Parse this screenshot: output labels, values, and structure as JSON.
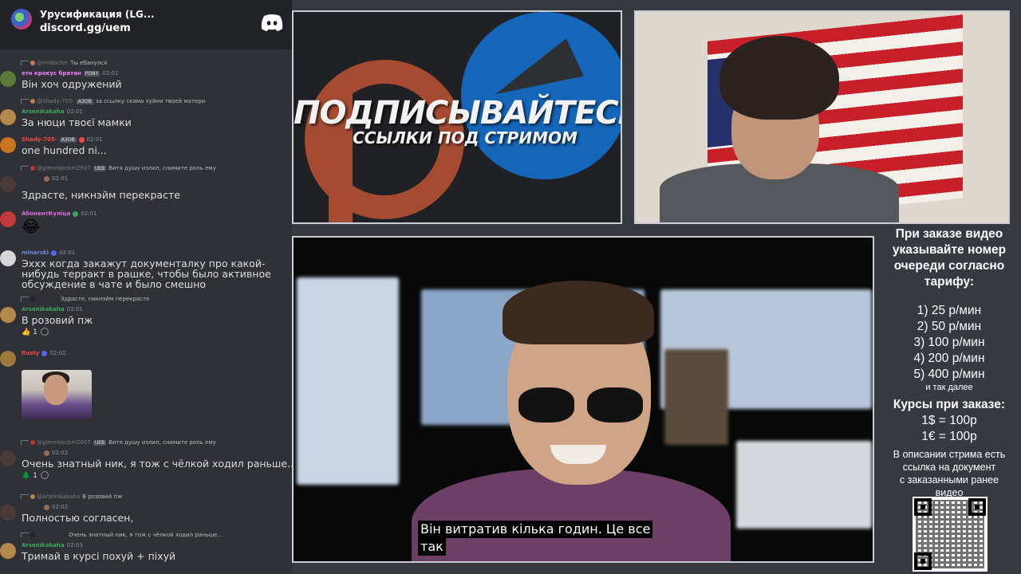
{
  "discord": {
    "server_name": "Урусификация (LG...",
    "invite": "discord.gg/uem",
    "messages": [
      {
        "reply_user": "@mrdoctor",
        "reply_text": "Ты ебанулся",
        "user": "ето крокус братан",
        "tag": "PONY",
        "time": "02:01",
        "text": "Він хоч одружений",
        "user_color": "#f47fff"
      },
      {
        "reply_user": "@Shady-705-",
        "reply_tag": "АЗОВ",
        "reply_text": "за ссылку скама хуйни твоей матери",
        "user": "Arsenikakaha",
        "time": "02:01",
        "text": "За нюци твоєї мамки",
        "user_color": "#3ba55d"
      },
      {
        "user": "Shady-705-",
        "tag": "АЗОВ",
        "time": "02:01",
        "text": "one hundred ni...",
        "user_color": "#f04747"
      },
      {
        "reply_user": "@glennbeckm2007",
        "reply_tag": "UEB",
        "reply_text": "Витя душу излил, снимите роль ему",
        "time": "02:01",
        "text": "Здрасте, никнэйм перекрасте"
      },
      {
        "user": "АбонентКуліца",
        "time": "02:01",
        "text": "😂",
        "user_color": "#e26de0"
      },
      {
        "user": "minarski",
        "time": "02:01",
        "text": "Эххх когда закажут документалку про какой-нибудь терракт в рашке, чтобы было активное обсуждение в чате и было смешно",
        "user_color": "#7289da"
      },
      {
        "reply_text": "Здрасте, никнэйм перекрасте",
        "user": "Arsenikakaha",
        "time": "02:01",
        "text": "В розовий пж",
        "reaction_count": "1",
        "user_color": "#3ba55d"
      },
      {
        "user": "Rusty",
        "time": "02:02",
        "user_color": "#f04747"
      },
      {
        "reply_user": "@glennbeckm2007",
        "reply_tag": "UEB",
        "reply_text": "Витя душу излил, снимите роль ему",
        "time": "02:02",
        "text": "Очень знатный ник, я тож с чёлкой ходил раньше...",
        "reaction_count": "1"
      },
      {
        "reply_user": "@Arsenikakaha",
        "reply_text": "В розовий пж",
        "time": "02:02",
        "text": "Полностью согласен,"
      },
      {
        "reply_text": "Очень знатный ник, я тож с чёлкой ходил раньше...",
        "user": "Arsenikakaha",
        "time": "02:03",
        "text": "Тримай в курсі похуй + піхуй",
        "user_color": "#3ba55d"
      }
    ]
  },
  "promo": {
    "title": "ПОДПИСЫВАЙТЕСЬ",
    "subtitle": "ССЫЛКИ ПОД СТРИМОМ"
  },
  "video": {
    "subtitle_line1": "Він витратив кілька годин.   Це все",
    "subtitle_line2": "так"
  },
  "info": {
    "heading": [
      "При заказе видео",
      "указывайте номер",
      "очереди согласно",
      "тарифу:"
    ],
    "tariffs": [
      "1) 25 р/мин",
      "2) 50 р/мин",
      "3) 100 р/мин",
      "4) 200 р/мин",
      "5) 400 р/мин"
    ],
    "more": "и так далее",
    "rates_heading": "Курсы при заказе:",
    "rates": [
      "1$ = 100р",
      "1€ = 100р"
    ],
    "description": [
      "В описании стрима есть",
      "ссылка на документ",
      "с заказанными ранее",
      "видео"
    ]
  },
  "colors": {
    "chat_bg": "#2f3136",
    "header_bg": "#202225",
    "page_bg": "#363a40",
    "text": "#dcddde"
  }
}
